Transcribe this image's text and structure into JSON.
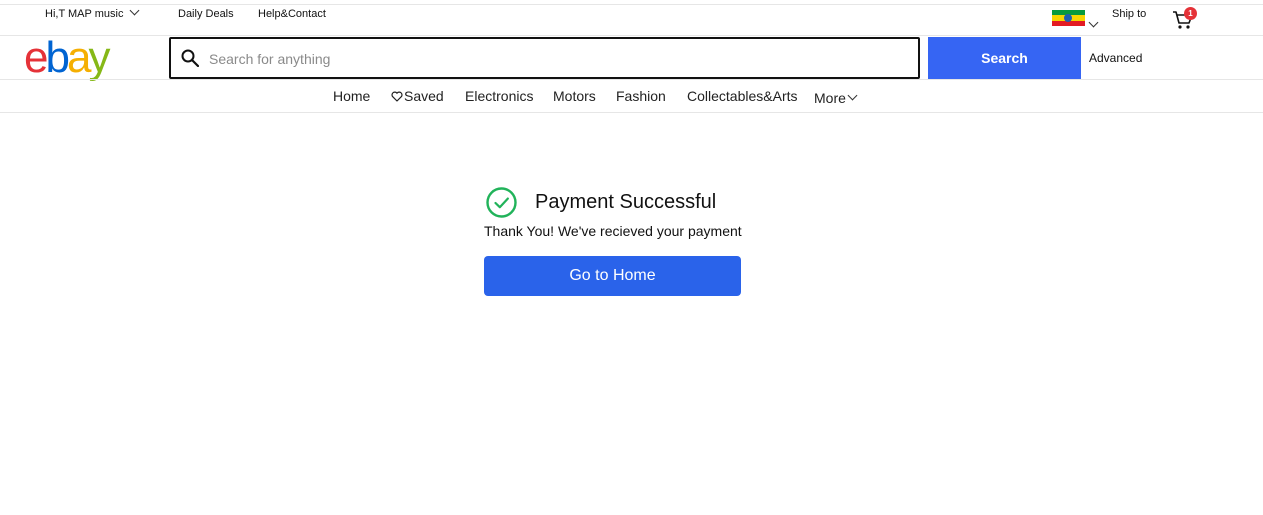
{
  "topbar": {
    "greeting": "Hi,T MAP music",
    "daily_deals": "Daily Deals",
    "help_contact": "Help&Contact",
    "ship_to": "Ship to",
    "cart_count": "1"
  },
  "header": {
    "logo": {
      "e": "e",
      "b": "b",
      "a": "a",
      "y": "y"
    },
    "search_placeholder": "Search for anything",
    "search_value": "",
    "search_button": "Search",
    "advanced": "Advanced"
  },
  "nav": {
    "home": "Home",
    "saved": "Saved",
    "electronics": "Electronics",
    "motors": "Motors",
    "fashion": "Fashion",
    "collectables": "Collectables&Arts",
    "more": "More"
  },
  "success": {
    "title": "Payment Successful",
    "message": "Thank You! We've recieved your payment",
    "button": "Go to Home"
  },
  "colors": {
    "primary_blue": "#3665f3",
    "success_green": "#21b35a",
    "badge_red": "#e53238"
  }
}
